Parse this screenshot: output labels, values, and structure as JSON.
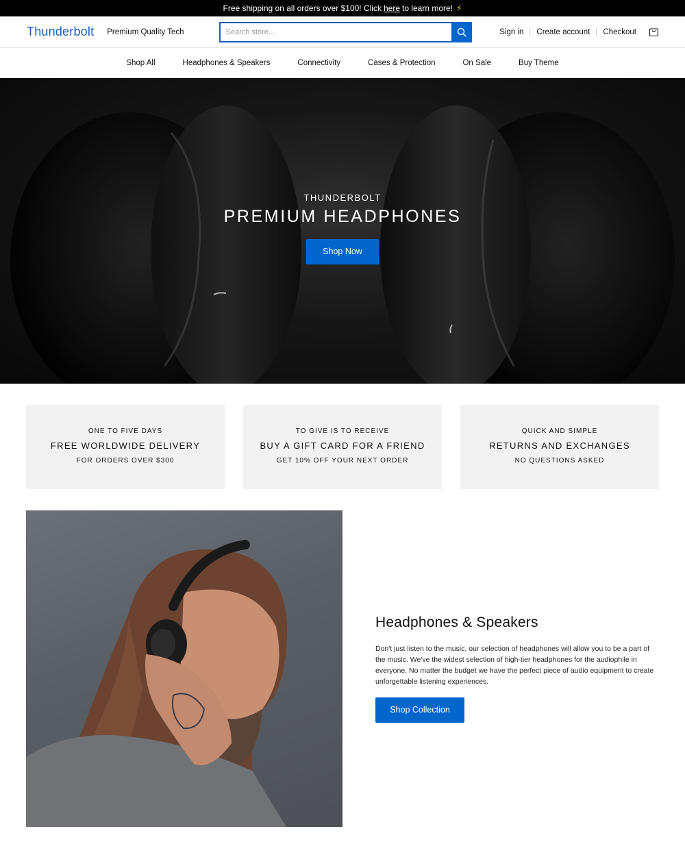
{
  "announcement": {
    "text_before": "Free shipping on all orders over $100! Click",
    "link": "here",
    "text_after": "to learn more!",
    "icon": "lightning-bolt-icon"
  },
  "header": {
    "logo": "Thunderbolt",
    "tagline": "Premium Quality Tech",
    "search_placeholder": "Search store...",
    "search_icon": "search-icon",
    "sign_in": "Sign in",
    "create_account": "Create account",
    "checkout": "Checkout",
    "cart_icon": "shopping-bag-icon"
  },
  "nav": {
    "items": [
      {
        "label": "Shop All"
      },
      {
        "label": "Headphones & Speakers"
      },
      {
        "label": "Connectivity"
      },
      {
        "label": "Cases & Protection"
      },
      {
        "label": "On Sale"
      },
      {
        "label": "Buy Theme"
      }
    ]
  },
  "hero": {
    "eyebrow": "THUNDERBOLT",
    "title": "PREMIUM HEADPHONES",
    "button": "Shop Now"
  },
  "features": [
    {
      "eyebrow": "ONE TO FIVE DAYS",
      "title": "FREE WORLDWIDE DELIVERY",
      "sub": "FOR ORDERS OVER $300"
    },
    {
      "eyebrow": "TO GIVE IS TO RECEIVE",
      "title": "BUY A GIFT CARD FOR A FRIEND",
      "sub": "GET 10% OFF YOUR NEXT ORDER"
    },
    {
      "eyebrow": "QUICK AND SIMPLE",
      "title": "RETURNS AND EXCHANGES",
      "sub": "NO QUESTIONS ASKED"
    }
  ],
  "promo": {
    "title": "Headphones & Speakers",
    "body": "Don't just listen to the music, our selection of headphones will allow you to be a part of the music. We've the widest selection of high-tier headphones for the audiophile in everyone. No matter the budget we have the perfect piece of audio equipment to create unforgettable listening experiences.",
    "button": "Shop Collection"
  },
  "colors": {
    "accent": "#0066cc",
    "logo": "#1a5fb4",
    "announcement_bg": "#000000",
    "feature_bg": "#f2f2f2"
  }
}
